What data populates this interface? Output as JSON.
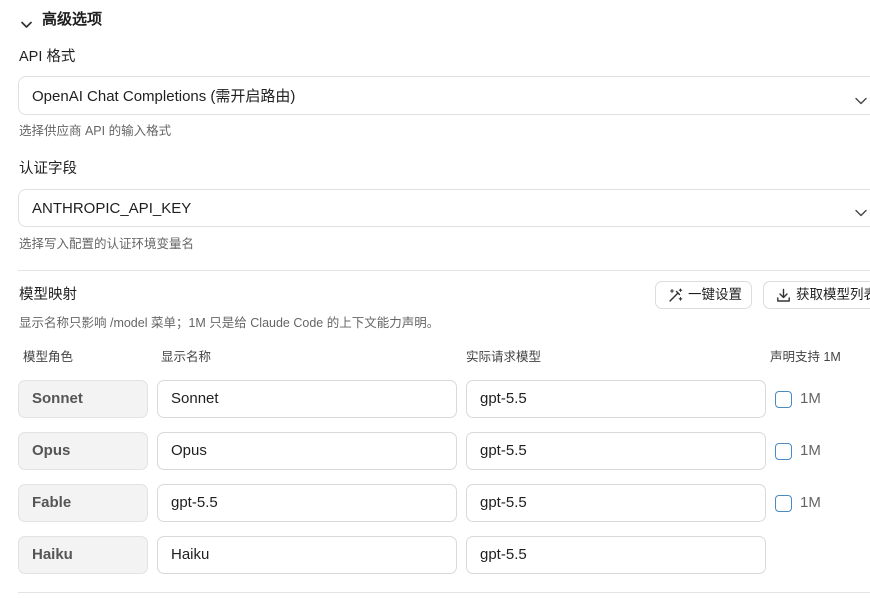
{
  "section": {
    "title": "高级选项"
  },
  "api_format": {
    "label": "API 格式",
    "value": "OpenAI Chat Completions (需开启路由)",
    "hint": "选择供应商 API 的输入格式"
  },
  "auth_field": {
    "label": "认证字段",
    "value": "ANTHROPIC_API_KEY",
    "hint": "选择写入配置的认证环境变量名"
  },
  "model_mapping": {
    "title": "模型映射",
    "description": "显示名称只影响 /model 菜单；1M 只是给 Claude Code 的上下文能力声明。",
    "buttons": {
      "quick_setup": "一键设置",
      "fetch_models": "获取模型列表"
    },
    "columns": [
      "模型角色",
      "显示名称",
      "实际请求模型",
      "声明支持 1M"
    ],
    "flag_label": "1M",
    "rows": [
      {
        "role": "Sonnet",
        "display_name": "Sonnet",
        "request_model": "gpt-5.5",
        "supports_1m": false
      },
      {
        "role": "Opus",
        "display_name": "Opus",
        "request_model": "gpt-5.5",
        "supports_1m": false
      },
      {
        "role": "Fable",
        "display_name": "gpt-5.5",
        "request_model": "gpt-5.5",
        "supports_1m": false
      },
      {
        "role": "Haiku",
        "display_name": "Haiku",
        "request_model": "gpt-5.5"
      }
    ]
  },
  "icons": [
    "chevron-down-icon",
    "magic-wand-icon",
    "download-icon"
  ],
  "colors": {
    "text": "#1f1f1f",
    "muted": "#666666",
    "border": "#dcdcdc",
    "role_bg": "#f3f3f3",
    "checkbox_border": "#4a8ac4"
  }
}
